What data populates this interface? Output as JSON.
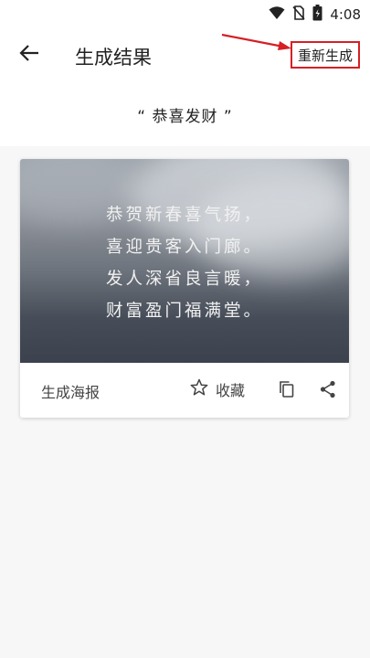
{
  "status_bar": {
    "time": "4:08",
    "icons": [
      "wifi-icon",
      "no-sim-icon",
      "battery-icon"
    ]
  },
  "app_bar": {
    "title": "生成结果",
    "back_icon": "arrow-left-icon",
    "regenerate_label": "重新生成"
  },
  "keyword": {
    "text": "“  恭喜发财  ”"
  },
  "poster": {
    "lines": [
      "恭贺新春喜气扬，",
      "喜迎贵客入门廊。",
      "发人深省良言暖，",
      "财富盈门福满堂。"
    ]
  },
  "actions": {
    "generate_poster_label": "生成海报",
    "favorite_label": "收藏",
    "favorite_icon": "star-outline-icon",
    "copy_icon": "copy-icon",
    "share_icon": "share-icon"
  },
  "colors": {
    "annotation_red": "#d61f26"
  }
}
